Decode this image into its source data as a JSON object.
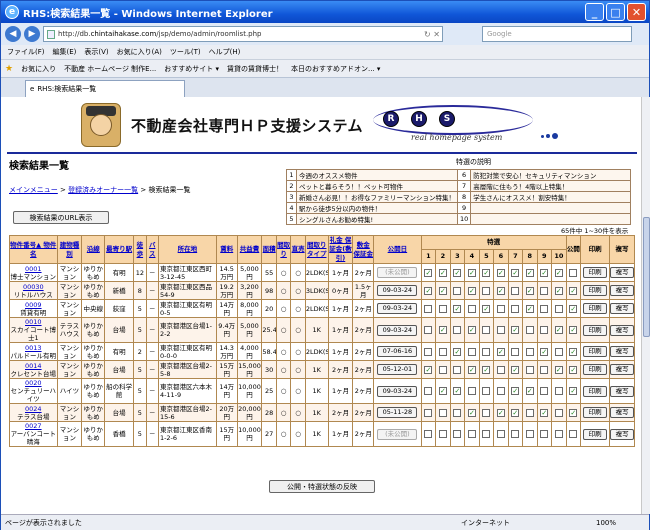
{
  "window": {
    "title": "RHS:検索結果一覧 - Windows Internet Explorer"
  },
  "address": {
    "prefix": "http://db.",
    "host": "chintaihakase.com",
    "path": "/jsp/demo/admin/roomlist.php",
    "search_placeholder": "Google"
  },
  "menu": [
    "ファイル(F)",
    "編集(E)",
    "表示(V)",
    "お気に入り(A)",
    "ツール(T)",
    "ヘルプ(H)"
  ],
  "favorites": [
    "お気に入り",
    "不動産 ホームページ 制作E...",
    "おすすめサイト ▾",
    "賃貸の賃貸博士！",
    "本日のおすすめアドオン... ▾"
  ],
  "tab": {
    "label": "RHS:検索結果一覧"
  },
  "banner": {
    "title": "不動産会社専門ＨＰ支援システム",
    "letters": [
      "R",
      "H",
      "S"
    ],
    "tagline": "real   homepage   system"
  },
  "page": {
    "title": "検索結果一覧",
    "crumb_menu": "メインメニュー",
    "crumb_owner": "登録済みオーナー一覧",
    "crumb_current": "検索結果一覧",
    "crumb_sep": " > ",
    "url_button": "検索結果のURL表示",
    "count": "65件中 1~30件を表示",
    "bottom_button": "公開・特選状態の反映"
  },
  "legend": {
    "title": "特選の説明",
    "items": [
      {
        "n": "1",
        "t": "今週のオススメ物件"
      },
      {
        "n": "2",
        "t": "ペットと暮らそう！！ペット可物件"
      },
      {
        "n": "3",
        "t": "新婚さん必見！！お得なファミリーマンション特集！"
      },
      {
        "n": "4",
        "t": "駅から徒歩5分以内の物件！"
      },
      {
        "n": "5",
        "t": "シングルさんお勧め特集!"
      },
      {
        "n": "6",
        "t": "防犯対策で安心！セキュリティマンション"
      },
      {
        "n": "7",
        "t": "高層階に住もう！4階以上特集！"
      },
      {
        "n": "8",
        "t": "学生さんにオススメ！割安特集！"
      },
      {
        "n": "9",
        "t": ""
      },
      {
        "n": "10",
        "t": ""
      }
    ]
  },
  "columns": {
    "no": "物件番号▲ 物件名",
    "type": "建物種別",
    "line": "沿線",
    "station": "最寄り駅",
    "walk": "徒歩",
    "bus": "バス",
    "addr": "所在地",
    "rent": "賃料",
    "fee": "共益費",
    "area": "面積",
    "hall": "間取り",
    "direct": "直売",
    "layout": "間取りタイプ",
    "key": "礼金 保証金(敷引)",
    "deposit": "敷金 保証金",
    "pub": "公開日",
    "tokusen": "特選",
    "open": "公開",
    "print": "印刷",
    "copy": "複写",
    "nums": [
      "1",
      "2",
      "3",
      "4",
      "5",
      "6",
      "7",
      "8",
      "9",
      "10"
    ]
  },
  "rows": [
    {
      "no": "0001",
      "name": "博士マンション",
      "type": "マンション",
      "line": "ゆりかもめ",
      "station": "有明",
      "walk": "12",
      "bus": "－",
      "addr": "東京都江東区西町3-12-45",
      "rent": "14.5万円",
      "fee": "5,000円",
      "area": "55",
      "hall": "○",
      "direct": "○",
      "layout": "2LDK(S)",
      "key": "1ヶ月",
      "deposit": "2ヶ月",
      "pub": "(未公開)",
      "pub_off": true,
      "checks": [
        1,
        1,
        1,
        1,
        1,
        1,
        1,
        1,
        1,
        1
      ],
      "print": "印刷",
      "copy": "複写"
    },
    {
      "no": "00030",
      "name": "リトルハウス",
      "type": "マンション",
      "line": "ゆりかもめ",
      "station": "新橋",
      "walk": "8",
      "bus": "－",
      "addr": "東京都江東区西品54-9",
      "rent": "19.2万円",
      "fee": "3,200円",
      "area": "98",
      "hall": "○",
      "direct": "○",
      "layout": "3LDK(S)",
      "key": "0ヶ月",
      "deposit": "1.5ヶ月",
      "pub": "09-03-24",
      "pub_off": false,
      "checks": [
        1,
        1,
        0,
        1,
        0,
        1,
        0,
        1,
        0,
        1
      ],
      "print": "印刷",
      "copy": "複写"
    },
    {
      "no": "0009",
      "name": "賃貸有明",
      "type": "マンション",
      "line": "中央線",
      "station": "荻窪",
      "walk": "5",
      "bus": "－",
      "addr": "東京都江東区有明0-5",
      "rent": "14万円",
      "fee": "8,000円",
      "area": "20",
      "hall": "○",
      "direct": "○",
      "layout": "2LDK(S)",
      "key": "1ヶ月",
      "deposit": "2ヶ月",
      "pub": "09-03-24",
      "pub_off": false,
      "checks": [
        0,
        0,
        1,
        0,
        1,
        0,
        0,
        1,
        0,
        0
      ],
      "print": "印刷",
      "copy": "複写"
    },
    {
      "no": "0010",
      "name": "スカイコート博士1",
      "type": "テラスハウス",
      "line": "ゆりかもめ",
      "station": "台場",
      "walk": "5",
      "bus": "－",
      "addr": "東京都港区台場1-2-2",
      "rent": "9.4万円",
      "fee": "5,000円",
      "area": "25.4",
      "hall": "○",
      "direct": "○",
      "layout": "1K",
      "key": "1ヶ月",
      "deposit": "2ヶ月",
      "pub": "09-03-24",
      "pub_off": false,
      "checks": [
        0,
        1,
        0,
        1,
        0,
        0,
        1,
        0,
        0,
        1
      ],
      "print": "印刷",
      "copy": "複写"
    },
    {
      "no": "0013",
      "name": "パルドール有明",
      "type": "マンション",
      "line": "ゆりかもめ",
      "station": "有明",
      "walk": "2",
      "bus": "－",
      "addr": "東京都江東区有明0-0-0",
      "rent": "14.3万円",
      "fee": "4,000円",
      "area": "58.4",
      "hall": "○",
      "direct": "○",
      "layout": "2LDK(S)",
      "key": "1ヶ月",
      "deposit": "2ヶ月",
      "pub": "07-06-16",
      "pub_off": false,
      "checks": [
        0,
        0,
        1,
        0,
        0,
        1,
        0,
        0,
        1,
        0
      ],
      "print": "印刷",
      "copy": "複写"
    },
    {
      "no": "0014",
      "name": "クレセント台場",
      "type": "マンション",
      "line": "ゆりかもめ",
      "station": "台場",
      "walk": "5",
      "bus": "－",
      "addr": "東京都港区台場2-5-8",
      "rent": "15万円",
      "fee": "15,000円",
      "area": "30",
      "hall": "○",
      "direct": "○",
      "layout": "1K",
      "key": "2ヶ月",
      "deposit": "2ヶ月",
      "pub": "05-12-01",
      "pub_off": false,
      "checks": [
        1,
        0,
        0,
        1,
        1,
        0,
        1,
        0,
        0,
        1
      ],
      "print": "印刷",
      "copy": "複写"
    },
    {
      "no": "0020",
      "name": "センチュリーハイツ",
      "type": "ハイツ",
      "line": "ゆりかもめ",
      "station": "船の科学館",
      "walk": "5",
      "bus": "－",
      "addr": "東京都港区六本木4-11-9",
      "rent": "14万円",
      "fee": "10,000円",
      "area": "25",
      "hall": "○",
      "direct": "○",
      "layout": "1K",
      "key": "1ヶ月",
      "deposit": "2ヶ月",
      "pub": "09-03-24",
      "pub_off": false,
      "checks": [
        0,
        1,
        1,
        0,
        0,
        0,
        1,
        1,
        0,
        0
      ],
      "print": "印刷",
      "copy": "複写"
    },
    {
      "no": "0024",
      "name": "テラス台場",
      "type": "マンション",
      "line": "ゆりかもめ",
      "station": "台場",
      "walk": "5",
      "bus": "－",
      "addr": "東京都港区台場2-15-6",
      "rent": "20万円",
      "fee": "20,000円",
      "area": "28",
      "hall": "○",
      "direct": "○",
      "layout": "1K",
      "key": "2ヶ月",
      "deposit": "2ヶ月",
      "pub": "05-11-28",
      "pub_off": false,
      "checks": [
        0,
        0,
        0,
        1,
        0,
        1,
        1,
        0,
        1,
        0
      ],
      "print": "印刷",
      "copy": "複写"
    },
    {
      "no": "0027",
      "name": "アーバンコート晴海",
      "type": "マンション",
      "line": "ゆりかもめ",
      "station": "香橋",
      "walk": "5",
      "bus": "－",
      "addr": "東京都江東区香南1-2-6",
      "rent": "15万円",
      "fee": "10,000円",
      "area": "27",
      "hall": "○",
      "direct": "○",
      "layout": "1K",
      "key": "1ヶ月",
      "deposit": "2ヶ月",
      "pub": "(未公開)",
      "pub_off": true,
      "checks": [
        0,
        0,
        0,
        0,
        0,
        0,
        0,
        0,
        0,
        0
      ],
      "print": "印刷",
      "copy": "複写"
    }
  ],
  "status": {
    "left": "ページが表示されました",
    "net": "インターネット",
    "zoom": "100%"
  }
}
